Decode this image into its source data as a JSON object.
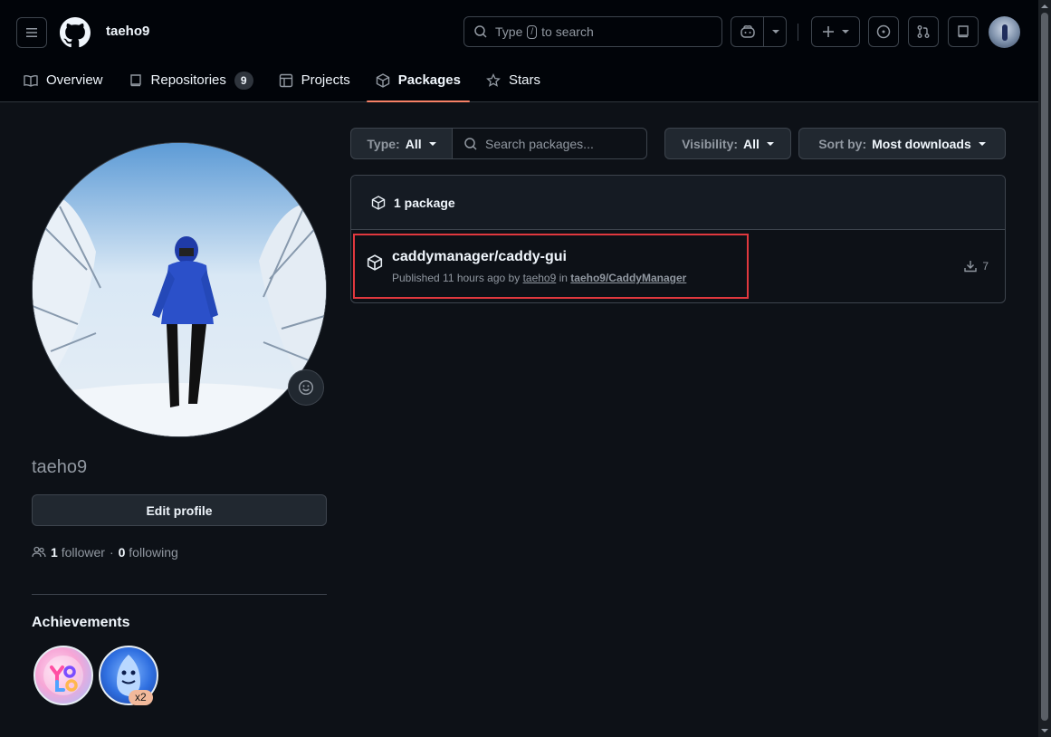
{
  "header": {
    "username": "taeho9",
    "search_prefix": "Type",
    "search_key": "/",
    "search_suffix": "to search"
  },
  "tabs": [
    {
      "label": "Overview",
      "icon": "book-icon"
    },
    {
      "label": "Repositories",
      "icon": "repo-icon",
      "count": "9"
    },
    {
      "label": "Projects",
      "icon": "table-icon"
    },
    {
      "label": "Packages",
      "icon": "package-icon",
      "active": true
    },
    {
      "label": "Stars",
      "icon": "star-icon"
    }
  ],
  "profile": {
    "name": "taeho9",
    "edit_label": "Edit profile",
    "followers_count": "1",
    "followers_label": "follower",
    "separator": "·",
    "following_count": "0",
    "following_label": "following",
    "achievements_title": "Achievements",
    "badge_multiplier": "x2"
  },
  "filters": {
    "type_key": "Type:",
    "type_value": "All",
    "search_placeholder": "Search packages...",
    "visibility_key": "Visibility:",
    "visibility_value": "All",
    "sort_key": "Sort by:",
    "sort_value": "Most downloads"
  },
  "packages": {
    "count_label": "1 package",
    "items": [
      {
        "name": "caddymanager/caddy-gui",
        "published": "Published 11 hours ago by",
        "author": "taeho9",
        "in_word": "in",
        "repo": "taeho9/CaddyManager",
        "downloads": "7"
      }
    ]
  },
  "colors": {
    "background": "#0d1117",
    "header_bg": "#010409",
    "active_tab_underline": "#f78166",
    "highlight_border": "#e0383e"
  }
}
